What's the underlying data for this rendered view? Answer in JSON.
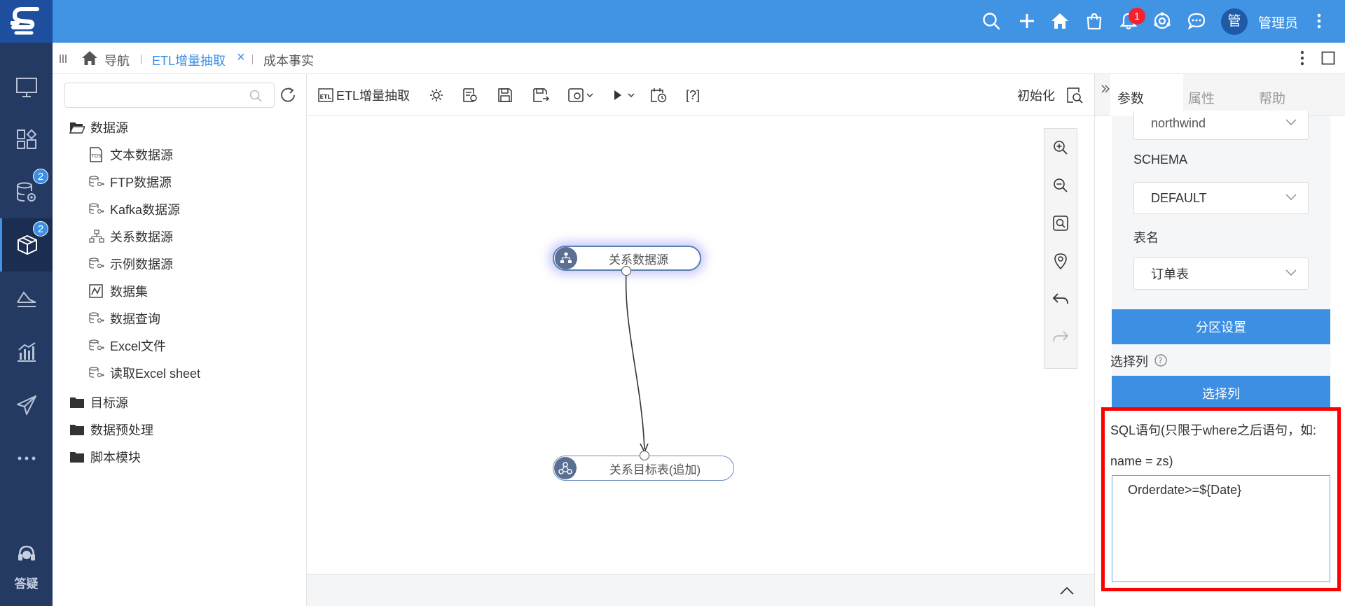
{
  "header": {
    "notification_count": "1",
    "avatar_text": "管",
    "username": "管理员"
  },
  "sidebar": {
    "badges": [
      "2",
      "2"
    ],
    "help_label": "答疑"
  },
  "tabs": {
    "nav_label": "导航",
    "active_tab": "ETL增量抽取",
    "close_glyph": "×",
    "other_tab": "成本事实"
  },
  "tree": {
    "search_placeholder": "",
    "groups": [
      {
        "label": "数据源",
        "children": [
          "文本数据源",
          "FTP数据源",
          "Kafka数据源",
          "关系数据源",
          "示例数据源",
          "数据集",
          "数据查询",
          "Excel文件",
          "读取Excel sheet"
        ]
      },
      {
        "label": "目标源"
      },
      {
        "label": "数据预处理"
      },
      {
        "label": "脚本模块"
      }
    ]
  },
  "toolbar": {
    "title": "ETL增量抽取",
    "help_text": "[?]",
    "init_label": "初始化"
  },
  "canvas": {
    "source_node": "关系数据源",
    "target_node": "关系目标表(追加)"
  },
  "right_panel": {
    "tabs": [
      "参数",
      "属性",
      "帮助"
    ],
    "database_value": "northwind",
    "schema_label": "SCHEMA",
    "schema_value": "DEFAULT",
    "table_label": "表名",
    "table_value": "订单表",
    "partition_button": "分区设置",
    "select_columns_label": "选择列",
    "select_columns_button": "选择列",
    "sql_label": "SQL语句(只限于where之后语句，如: name = zs)",
    "sql_value": "Orderdate>=${Date}"
  },
  "colors": {
    "topbar": "#4193e4",
    "sidebar": "#253a63",
    "primary_button": "#3d8fe3",
    "highlight": "#ff0000"
  }
}
